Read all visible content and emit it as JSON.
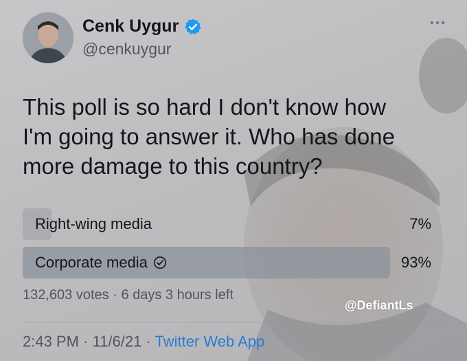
{
  "author": {
    "display_name": "Cenk Uygur",
    "handle": "@cenkuygur",
    "verified": true
  },
  "tweet": {
    "text_lines": [
      "This poll is so hard I don't know how",
      "I'm going to answer it. Who has done",
      "more damage to this country?"
    ]
  },
  "poll": {
    "options": [
      {
        "label": "Right-wing media",
        "percent_text": "7%",
        "percent": 7,
        "selected": false
      },
      {
        "label": "Corporate media",
        "percent_text": "93%",
        "percent": 93,
        "selected": true
      }
    ],
    "votes": "132,603 votes",
    "separator": "·",
    "time_left": "6 days 3 hours left"
  },
  "footer": {
    "time": "2:43 PM",
    "date": "11/6/21",
    "separator": "·",
    "source": "Twitter Web App"
  },
  "watermark": "@DefiantLs",
  "colors": {
    "verified_badge": "#1d9bf0",
    "link": "#2a7bd1"
  },
  "icons": {
    "verified": "verified-badge-icon",
    "more": "more-options-icon",
    "selected": "check-circle-icon"
  }
}
